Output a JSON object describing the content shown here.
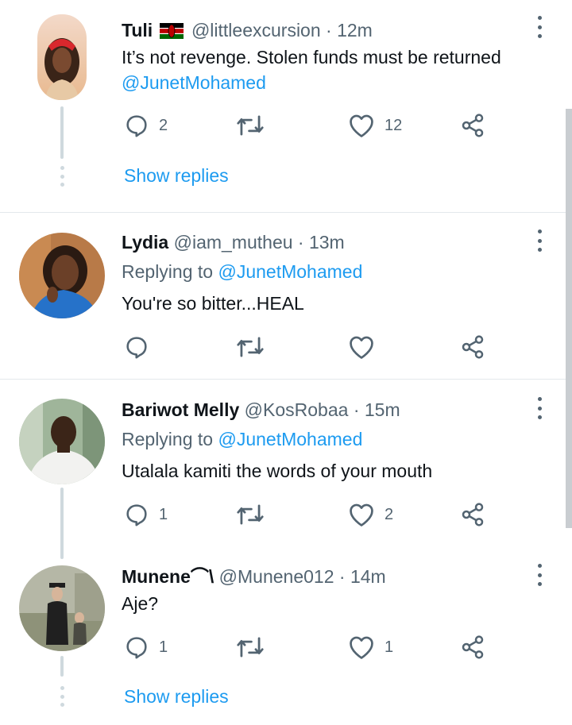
{
  "colors": {
    "accent": "#1d9bf0",
    "secondary": "#536471",
    "thread": "#cfd9de",
    "flag_red": "#bb0000",
    "flag_green": "#006600"
  },
  "tweets": [
    {
      "name": "Tuli",
      "has_flag": true,
      "handle": "@littleexcursion",
      "time": "· 12m",
      "body": "It’s not revenge. Stolen funds must be returned",
      "body_mention": "@JunetMohamed",
      "replies": "2",
      "likes": "12",
      "show_replies": "Show replies"
    },
    {
      "name": "Lydia",
      "handle": "@iam_mutheu",
      "time": "· 13m",
      "replying_prefix": "Replying to",
      "replying_to": "@JunetMohamed",
      "body": "You're so bitter...HEAL"
    },
    {
      "name": "Bariwot Melly",
      "handle": "@KosRobaa",
      "time": "· 15m",
      "replying_prefix": "Replying to",
      "replying_to": "@JunetMohamed",
      "body": "Utalala kamiti the words of your mouth",
      "replies": "1",
      "likes": "2"
    },
    {
      "name": "Munene⌒\\",
      "handle": "@Munene012",
      "time": "· 14m",
      "body": "Aje?",
      "replies": "1",
      "likes": "1",
      "show_replies": "Show replies"
    }
  ],
  "icons": {
    "reply": "reply-icon",
    "retweet": "retweet-icon",
    "like": "like-icon",
    "share": "share-icon",
    "more": "more-icon"
  }
}
